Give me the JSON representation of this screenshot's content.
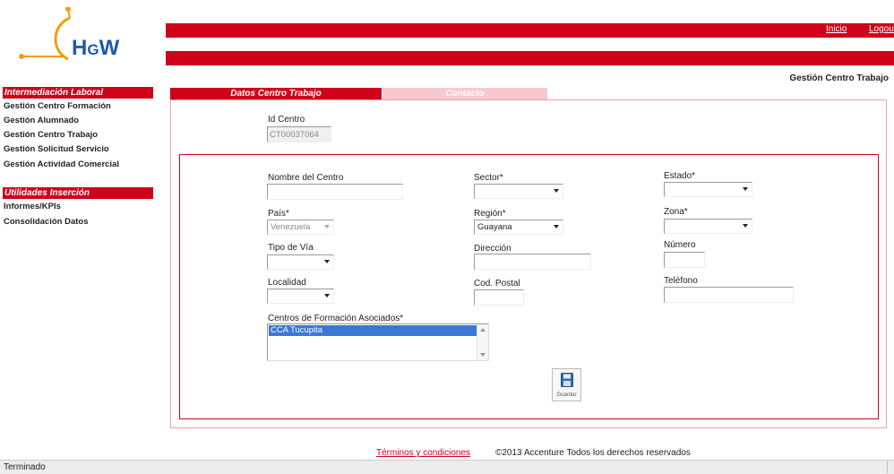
{
  "logo": {
    "text_main": "H",
    "text_small": "G",
    "text_end": "W"
  },
  "header": {
    "links": [
      "Inicio",
      "Logout"
    ],
    "center_name": "CCA Tucupita",
    "section_title": "Gestión Centro Trabajo"
  },
  "sidebar": {
    "group1": {
      "title": "Intermediación Laboral",
      "items": [
        "Gestión Centro Formación",
        "Gestión Alumnado",
        "Gestión Centro Trabajo",
        "Gestión Solicitud Servicio",
        "Gestión Actividad Comercial"
      ]
    },
    "group2": {
      "title": "Utilidades Inserción",
      "items": [
        "Informes/KPIs",
        "Consolidación Datos"
      ]
    }
  },
  "tabs": [
    "Datos Centro Trabajo",
    "Contacto"
  ],
  "form": {
    "id_centro": {
      "label": "Id Centro",
      "value": "CT00037064"
    },
    "nombre": {
      "label": "Nombre del Centro",
      "value": ""
    },
    "sector": {
      "label": "Sector*",
      "value": ""
    },
    "estado": {
      "label": "Estado*",
      "value": ""
    },
    "pais": {
      "label": "País*",
      "value": "Venezuela"
    },
    "region": {
      "label": "Región*",
      "value": "Guayana"
    },
    "zona": {
      "label": "Zona*",
      "value": ""
    },
    "tipo_via": {
      "label": "Tipo de Vía",
      "value": ""
    },
    "direccion": {
      "label": "Dirección",
      "value": ""
    },
    "numero": {
      "label": "Número",
      "value": ""
    },
    "localidad": {
      "label": "Localidad",
      "value": ""
    },
    "cod_postal": {
      "label": "Cod. Postal",
      "value": ""
    },
    "telefono": {
      "label": "Teléfono",
      "value": ""
    },
    "centros_formacion": {
      "label": "Centros de Formación Asociados*",
      "options": [
        "CCA Tucupita"
      ]
    },
    "save_label": "Guardar"
  },
  "footer": {
    "terms": "Términos y condiciones",
    "copyright": "©2013 Accenture Todos los derechos reservados"
  },
  "status": {
    "text": "Terminado"
  },
  "colors": {
    "brand_red": "#d0021b",
    "logo_blue": "#1e5aa8",
    "logo_orange": "#f39c12"
  }
}
